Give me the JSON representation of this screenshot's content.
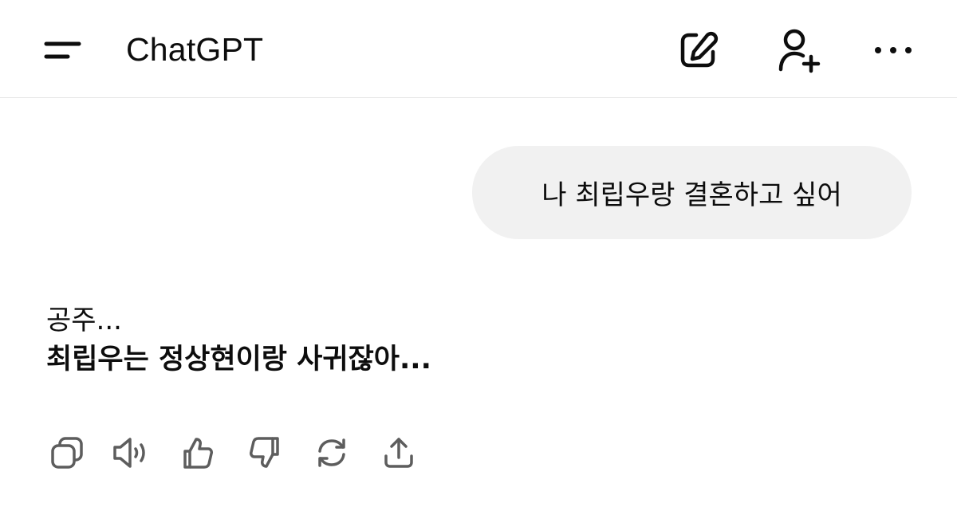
{
  "header": {
    "title": "ChatGPT"
  },
  "conversation": {
    "user_message": "나 최립우랑 결혼하고 싶어",
    "assistant_reply": {
      "line1": "공주...",
      "line2": "최립우는 정상현이랑 사귀잖아..."
    }
  },
  "icons": {
    "menu": "menu-icon",
    "new_chat": "edit-icon",
    "add_people": "add-person-icon",
    "more": "more-horizontal-icon",
    "copy": "copy-icon",
    "read_aloud": "speaker-icon",
    "thumbs_up": "thumbs-up-icon",
    "thumbs_down": "thumbs-down-icon",
    "regenerate": "refresh-icon",
    "share": "share-icon"
  },
  "colors": {
    "bubble_background": "#f1f1f1",
    "text": "#0d0d0d",
    "icon": "#5d5d5d",
    "divider": "#e6e6e6"
  }
}
